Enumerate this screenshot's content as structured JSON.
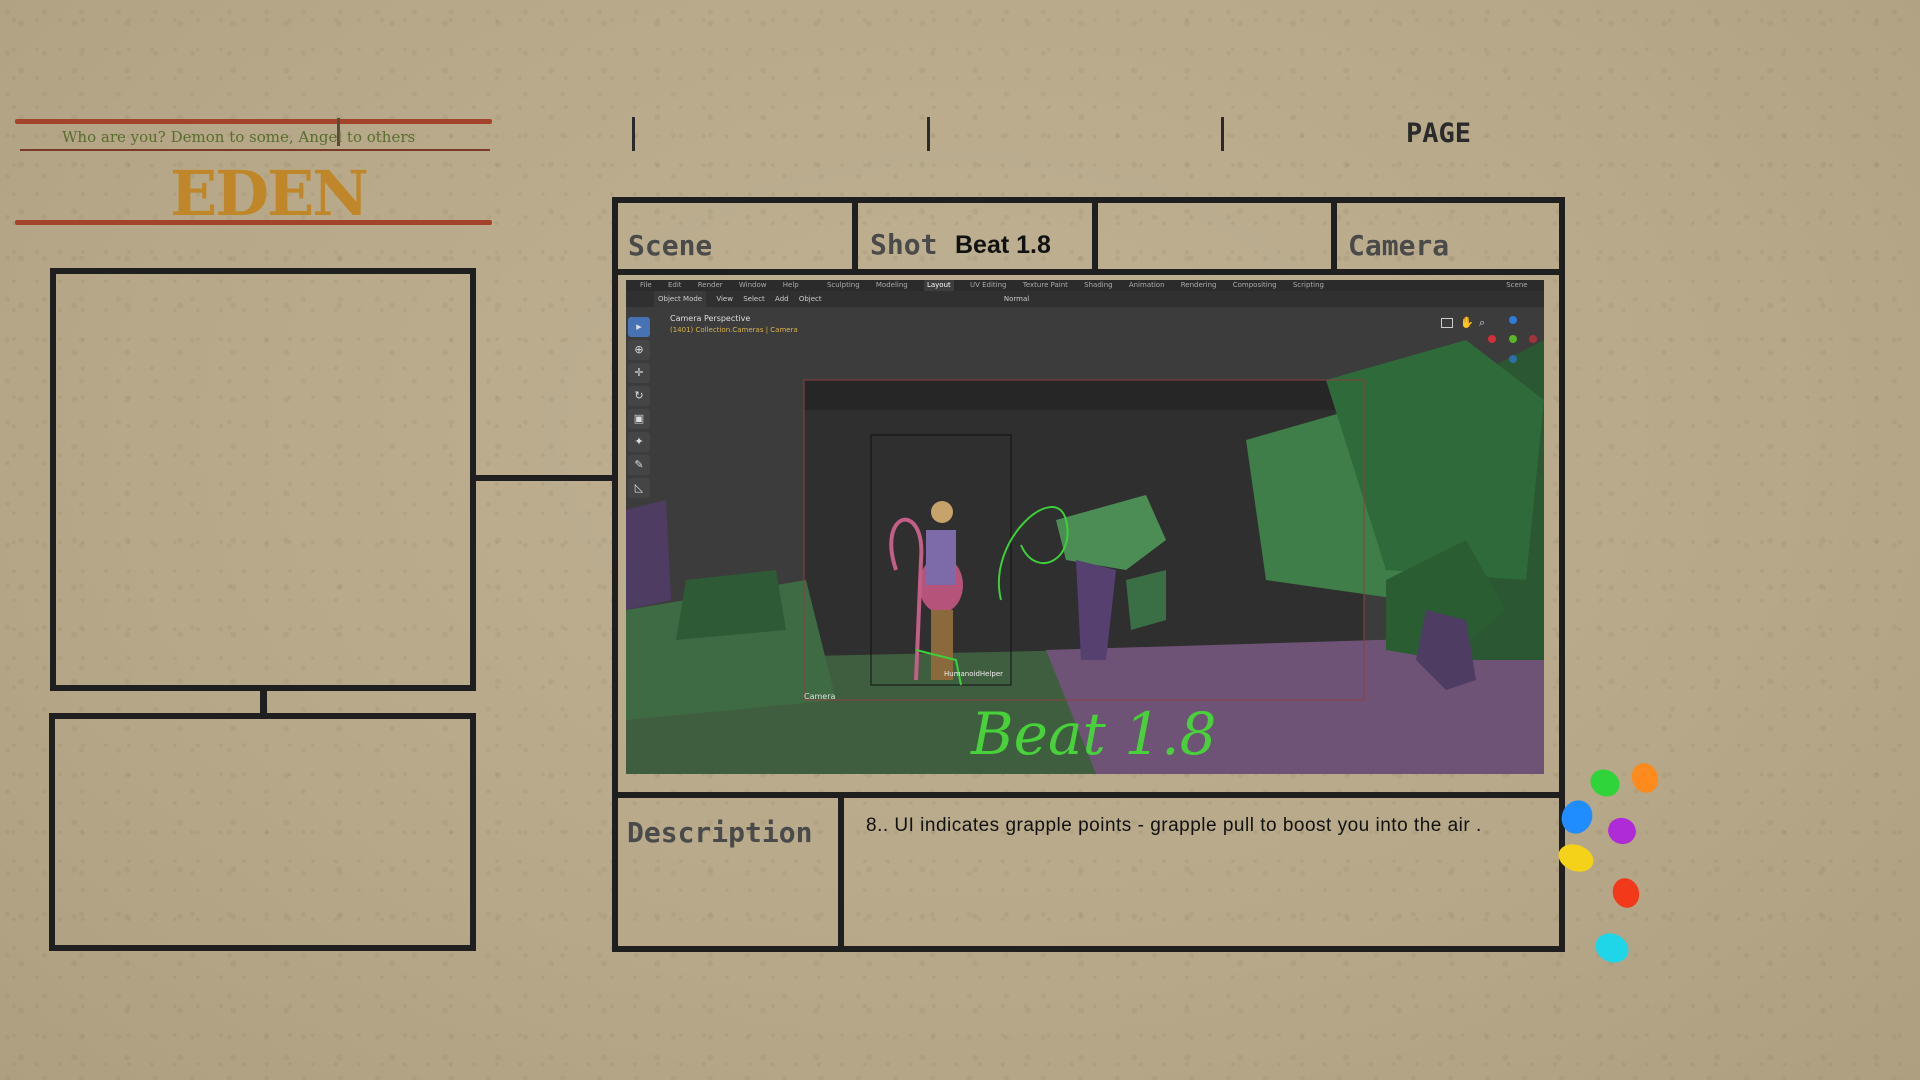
{
  "header": {
    "tagline": "Who are you? Demon to some, Angel to others",
    "brand": "EDEN",
    "page_label": "PAGE"
  },
  "frame": {
    "scene_label": "Scene",
    "shot_label": "Shot",
    "shot_value": "Beat 1.8",
    "camera_label": "Camera",
    "description_label": "Description",
    "description_text": "8.. UI indicates grapple points - grapple pull to boost you into the air ."
  },
  "blender": {
    "menu": [
      "File",
      "Edit",
      "Render",
      "Window",
      "Help"
    ],
    "workspaces": [
      "Sculpting",
      "Modeling",
      "Layout",
      "UV Editing",
      "Texture Paint",
      "Shading",
      "Animation",
      "Rendering",
      "Compositing",
      "Scripting"
    ],
    "active_workspace": "Layout",
    "scene_name": "Scene",
    "mode": "Object Mode",
    "header_menus": [
      "View",
      "Select",
      "Add",
      "Object"
    ],
    "transform": "Normal",
    "view_title": "Camera Perspective",
    "view_subtitle": "(1401) Collection.Cameras | Camera",
    "camera_object_label": "Camera",
    "rig_label": "HumanoidHelper",
    "sketch_text": "Beat 1.8"
  },
  "colors": {
    "border": "#1f1f1f",
    "accent_red": "#a4432b",
    "brand_gold": "#c0872a",
    "tag_green": "#5a6d2e",
    "sketch_green": "#48d13a",
    "paint_dots": [
      "#2fd43a",
      "#ff8a1e",
      "#1f8cff",
      "#b02bd8",
      "#f4d21a",
      "#f23a1a",
      "#1fd6e8"
    ]
  }
}
